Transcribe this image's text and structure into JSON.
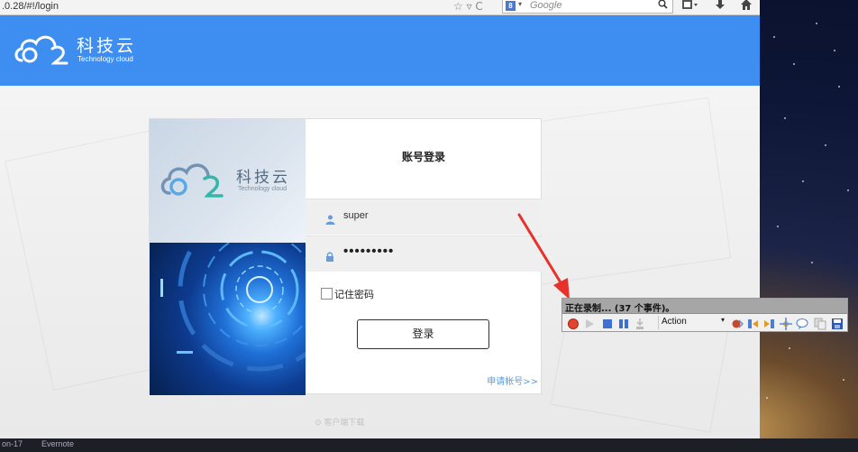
{
  "browser": {
    "url": ".0.28/#!/login",
    "url_icons": "☆ ▿ C",
    "search_engine_icon": "google-g-icon",
    "search_engine_letter": "8",
    "search_placeholder": "Google",
    "toolbar_icons": [
      "bookmark-menu-icon",
      "download-icon",
      "home-icon"
    ]
  },
  "header": {
    "logo_cn": "科技云",
    "logo_en": "Technology cloud"
  },
  "card": {
    "art_logo_cn": "科技云",
    "art_logo_en": "Technology cloud",
    "title": "账号登录",
    "username": "super",
    "password_mask": "•••••••••",
    "remember_label": "记住密码",
    "remember_checked": false,
    "login_button": "登录",
    "apply_link": "申请帐号>>"
  },
  "footer": {
    "download": "⊙ 客户端下载"
  },
  "recorder": {
    "title": "正在录制... (37 个事件)。",
    "action_select": "Action",
    "caret": "▾"
  },
  "taskbar": {
    "items": [
      "on-17",
      "Evernote"
    ]
  },
  "colors": {
    "header_blue": "#3d8ef0",
    "link_blue": "#5b9bd9",
    "arrow_red": "#e8312b"
  }
}
